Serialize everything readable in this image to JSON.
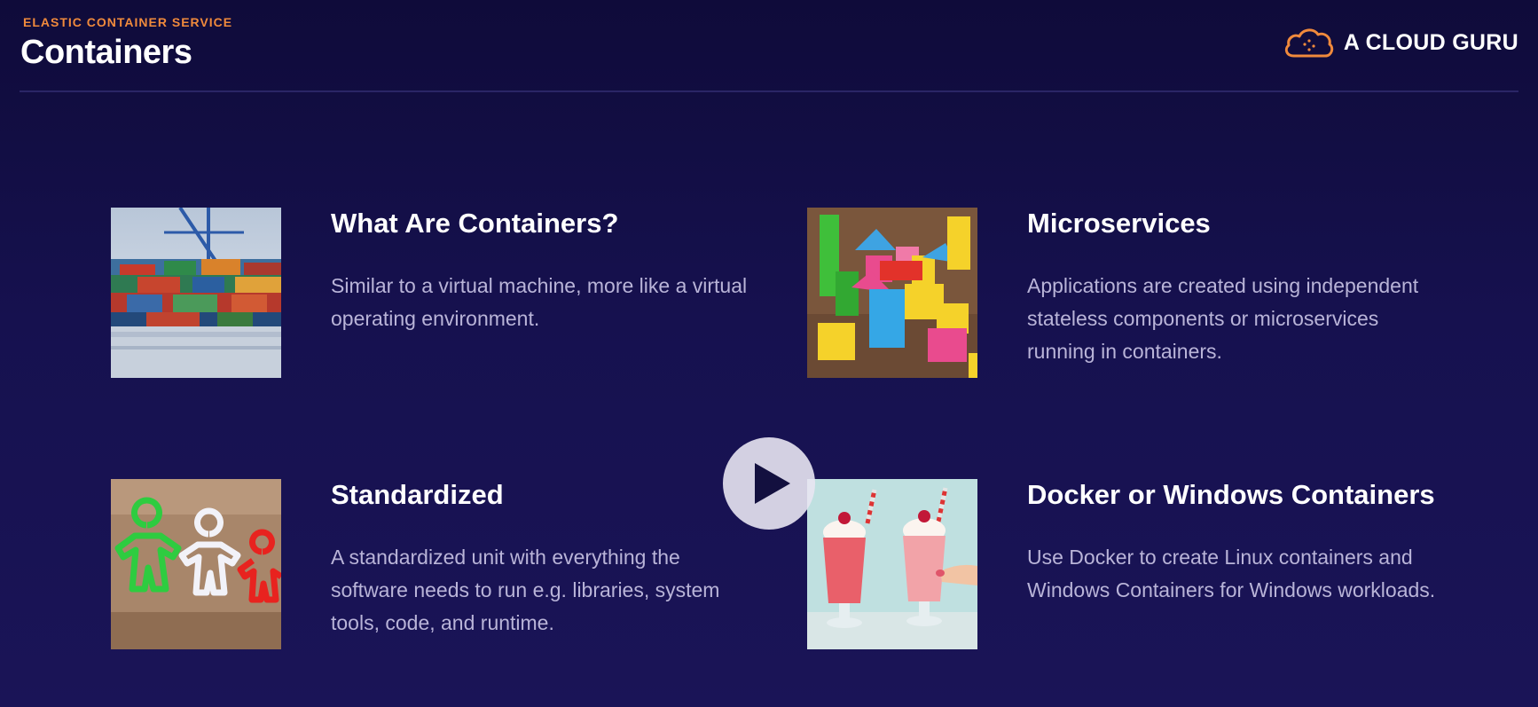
{
  "header": {
    "eyebrow": "ELASTIC CONTAINER SERVICE",
    "title": "Containers",
    "logo_text": "A CLOUD GURU"
  },
  "colors": {
    "background": "#16114f",
    "accent": "#f08a3c",
    "body_text": "#b9b4d8"
  },
  "cards": [
    {
      "title": "What Are Containers?",
      "description": "Similar to a virtual machine, more like a virtual operating environment.",
      "icon": "shipping-containers-photo"
    },
    {
      "title": "Microservices",
      "description": "Applications are created using independent stateless components or microservices running in containers.",
      "icon": "building-blocks-photo"
    },
    {
      "title": "Standardized",
      "description": "A standardized unit with everything the software needs to run e.g. libraries, system tools, code, and runtime.",
      "icon": "cookie-cutters-photo"
    },
    {
      "title": "Docker or Windows Containers",
      "description": "Use Docker to create Linux containers and Windows Containers for Windows workloads.",
      "icon": "milkshakes-photo"
    }
  ],
  "player": {
    "icon": "play-icon"
  }
}
